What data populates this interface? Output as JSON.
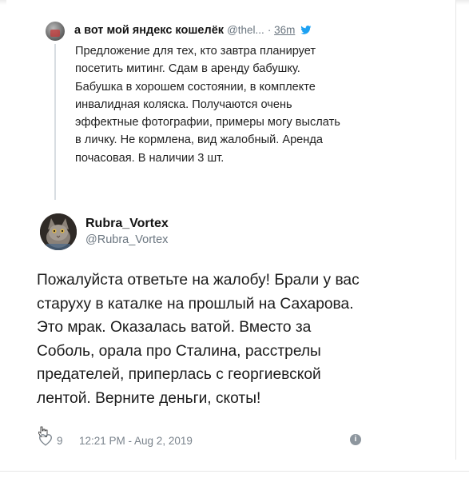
{
  "parent_tweet": {
    "author_name": "а вот мой яндекс кошелёк",
    "handle": "@thel...",
    "time": "36m",
    "text": "Предложение для тех, кто завтра планирует посетить митинг. Сдам в аренду бабушку. Бабушка в хорошем состоянии, в комплекте инвалидная коляска. Получаются очень эффектные фотографии, примеры могу выслать в личку. Не кормлена, вид жалобный. Аренда почасовая. В наличии 3 шт."
  },
  "reply": {
    "author_name": "Rubra_Vortex",
    "handle": "@Rubra_Vortex",
    "text": "Пожалуйста ответьте на жалобу! Брали у вас старуху в каталке на прошлый на Сахарова. Это мрак. Оказалась ватой. Вместо за Соболь, орала про Сталина, расстрелы предателей, приперлась с георгиевской лентой. Верните деньги, скоты!",
    "like_count": "9",
    "timestamp": "12:21 PM - Aug 2, 2019",
    "info_glyph": "i"
  },
  "icons": {
    "verified_bird": "twitter-bird-icon",
    "like": "heart-icon",
    "info": "info-icon",
    "cursor": "hand-cursor-icon"
  },
  "colors": {
    "twitter_blue": "#1da1f2",
    "handle_gray": "#6b7680"
  }
}
